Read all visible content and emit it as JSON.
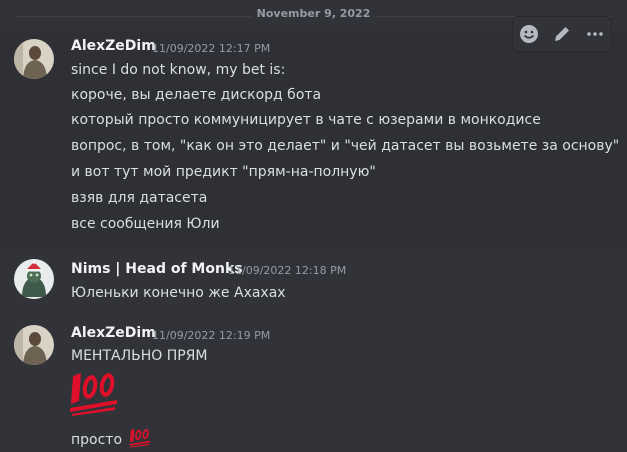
{
  "divider": {
    "date": "November 9, 2022"
  },
  "toolbar": {
    "icons": [
      "add-reaction-icon",
      "edit-icon",
      "more-icon"
    ]
  },
  "messages": [
    {
      "author": "AlexZeDim",
      "timestamp": "11/09/2022 12:17 PM",
      "lines": [
        "since I do not know, my bet is:",
        "короче, вы делаете дискорд бота",
        "который просто коммуницирует в чате с юзерами в монкодисе",
        "вопрос, в том, \"как он это делает\" и \"чей датасет вы возьмете за основу\"",
        "и вот тут мой предикт \"прям-на-полную\"",
        "взяв для датасета",
        "все сообщения Юли"
      ]
    },
    {
      "author": "Nims | Head of Monks",
      "timestamp": "11/09/2022 12:18 PM",
      "lines": [
        "Юленьки конечно же Ахахах"
      ]
    },
    {
      "author": "AlexZeDim",
      "timestamp": "11/09/2022 12:19 PM",
      "lines": [
        "МЕНТАЛЬНО ПРЯМ",
        "просто"
      ],
      "emoji": "hundred-points-emoji"
    }
  ],
  "colors": {
    "background": "#313338",
    "hover": "#2e3035",
    "emoji_red": "#e0102b"
  }
}
